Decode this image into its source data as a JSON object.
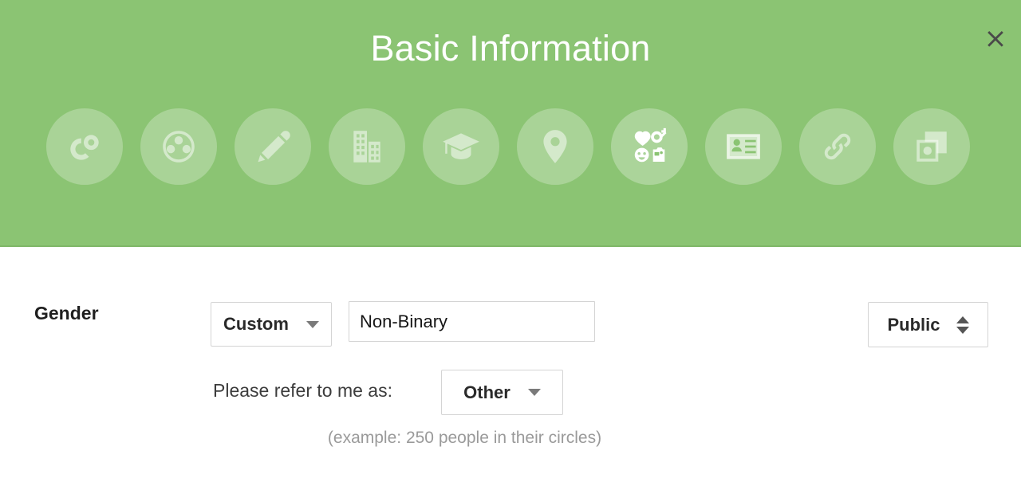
{
  "header": {
    "title": "Basic Information",
    "background_color": "#8bc473",
    "title_color": "#ffffff",
    "close_label": "✕",
    "close_icon": "close-icon"
  },
  "nav": {
    "items": [
      {
        "icon": "circles-icon",
        "label": "Circles",
        "active": false
      },
      {
        "icon": "people-group-icon",
        "label": "People",
        "active": false
      },
      {
        "icon": "pencil-icon",
        "label": "Story",
        "active": false
      },
      {
        "icon": "building-icon",
        "label": "Work",
        "active": false
      },
      {
        "icon": "graduation-cap-icon",
        "label": "Education",
        "active": false
      },
      {
        "icon": "location-pin-icon",
        "label": "Places",
        "active": false
      },
      {
        "icon": "basic-info-icon",
        "label": "Basic Information",
        "active": true
      },
      {
        "icon": "contact-card-icon",
        "label": "Contact Info",
        "active": false
      },
      {
        "icon": "link-chain-icon",
        "label": "Links",
        "active": false
      },
      {
        "icon": "photos-icon",
        "label": "Photos",
        "active": false
      }
    ]
  },
  "form": {
    "gender": {
      "label": "Gender",
      "type_value": "Custom",
      "custom_value": "Non-Binary",
      "custom_placeholder": "",
      "visibility_value": "Public"
    },
    "pronoun": {
      "label": "Please refer to me as:",
      "value": "Other",
      "example": "(example: 250 people in their circles)"
    }
  }
}
